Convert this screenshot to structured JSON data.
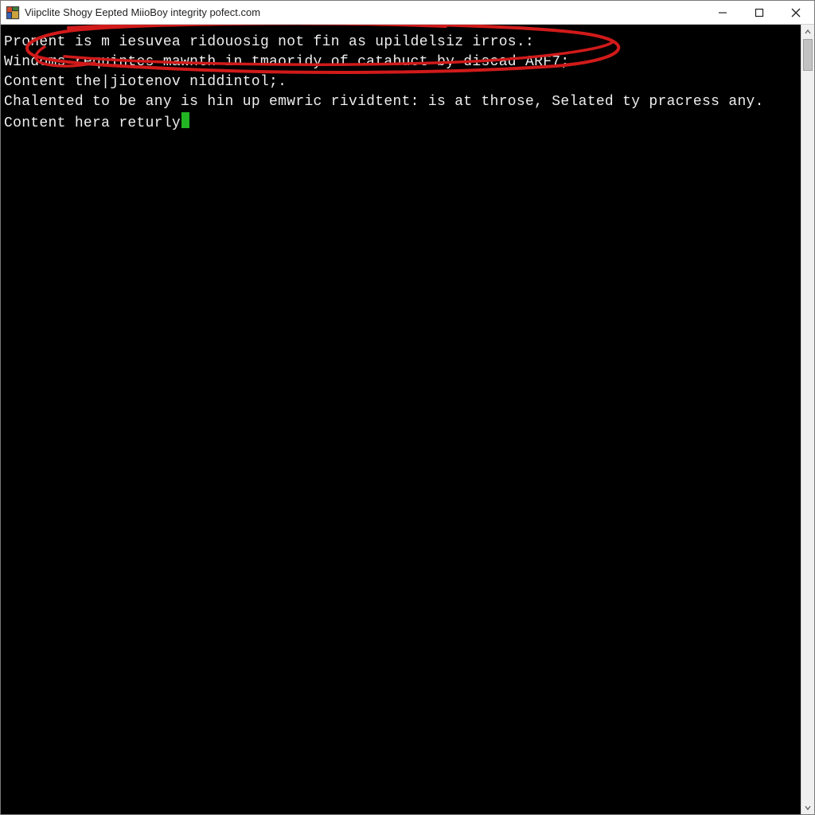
{
  "titlebar": {
    "title": "Viipclite Shogy Eepted MiioBoy integrity pofect.com"
  },
  "console": {
    "lines": [
      "Pronent is m iesuvea ridouosig not fin as upildelsiz irros.:",
      "Windoms requintes mawnth in tmaoridy of catabuct by discad ARF7;",
      "Content the|jiotenov niddintol;.",
      "Chalented to be any is hin up emwric rividtent: is at throse, Selated ty pracress any.",
      "Content hera returly"
    ]
  },
  "colors": {
    "cursor": "#22b422",
    "annotation": "#d11a1a"
  }
}
